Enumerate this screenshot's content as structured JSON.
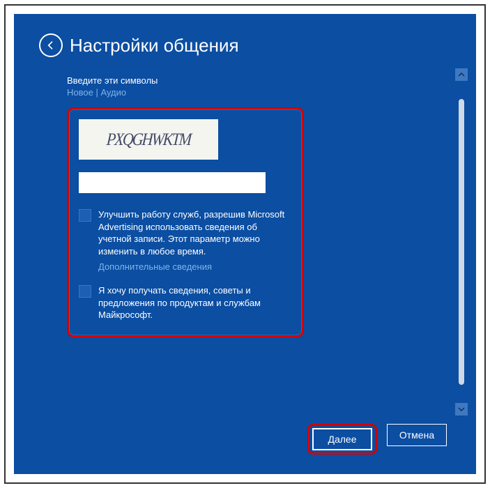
{
  "header": {
    "title": "Настройки общения"
  },
  "content": {
    "instruction": "Введите эти символы",
    "link_new": "Новое",
    "link_sep": " | ",
    "link_audio": "Аудио",
    "captcha_text": "PXQGHWKTM",
    "captcha_value": "",
    "checkbox1_label": "Улучшить работу служб, разрешив Microsoft Advertising использовать сведения об учетной записи. Этот параметр можно изменить в любое время.",
    "more_info": "Дополнительные сведения",
    "checkbox2_label": "Я хочу получать сведения, советы и предложения по продуктам и службам Майкрософт."
  },
  "footer": {
    "next_label": "Далее",
    "cancel_label": "Отмена"
  }
}
